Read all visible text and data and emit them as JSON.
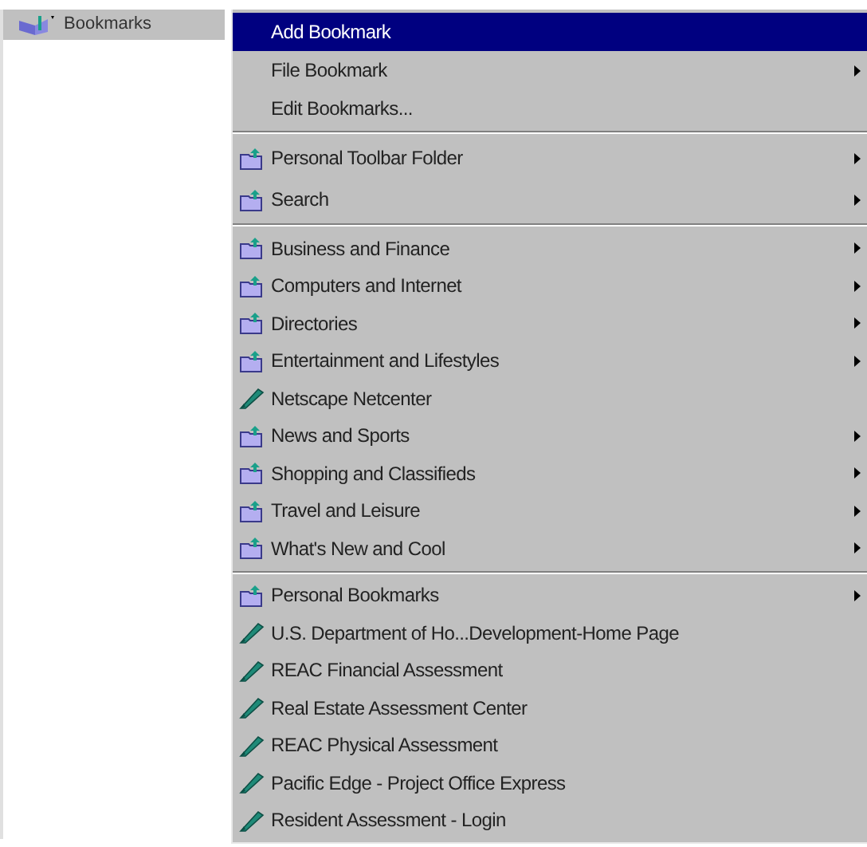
{
  "bookmarks_button": {
    "label": "Bookmarks"
  },
  "menu": {
    "groups": [
      {
        "items": [
          {
            "kind": "command",
            "label": "Add Bookmark",
            "selected": true,
            "has_submenu": false
          },
          {
            "kind": "command",
            "label": "File Bookmark",
            "selected": false,
            "has_submenu": true
          },
          {
            "kind": "command",
            "label": "Edit Bookmarks...",
            "selected": false,
            "has_submenu": false
          }
        ]
      },
      {
        "items": [
          {
            "kind": "folder",
            "label": "Personal Toolbar Folder",
            "selected": false,
            "has_submenu": true
          },
          {
            "kind": "folder",
            "label": "Search",
            "selected": false,
            "has_submenu": true
          }
        ]
      },
      {
        "items": [
          {
            "kind": "folder",
            "label": "Business and Finance",
            "selected": false,
            "has_submenu": true
          },
          {
            "kind": "folder",
            "label": "Computers and Internet",
            "selected": false,
            "has_submenu": true
          },
          {
            "kind": "folder",
            "label": "Directories",
            "selected": false,
            "has_submenu": true
          },
          {
            "kind": "folder",
            "label": "Entertainment and Lifestyles",
            "selected": false,
            "has_submenu": true
          },
          {
            "kind": "bookmark",
            "label": "Netscape Netcenter",
            "selected": false,
            "has_submenu": false
          },
          {
            "kind": "folder",
            "label": "News and Sports",
            "selected": false,
            "has_submenu": true
          },
          {
            "kind": "folder",
            "label": "Shopping and Classifieds",
            "selected": false,
            "has_submenu": true
          },
          {
            "kind": "folder",
            "label": "Travel and Leisure",
            "selected": false,
            "has_submenu": true
          },
          {
            "kind": "folder",
            "label": "What's New and Cool",
            "selected": false,
            "has_submenu": true
          }
        ]
      },
      {
        "items": [
          {
            "kind": "folder",
            "label": "Personal Bookmarks",
            "selected": false,
            "has_submenu": true
          },
          {
            "kind": "bookmark",
            "label": "U.S. Department of Ho...Development-Home Page",
            "selected": false,
            "has_submenu": false
          },
          {
            "kind": "bookmark",
            "label": "REAC Financial Assessment",
            "selected": false,
            "has_submenu": false
          },
          {
            "kind": "bookmark",
            "label": "Real Estate Assessment Center",
            "selected": false,
            "has_submenu": false
          },
          {
            "kind": "bookmark",
            "label": "REAC Physical Assessment",
            "selected": false,
            "has_submenu": false
          },
          {
            "kind": "bookmark",
            "label": "Pacific Edge - Project Office Express",
            "selected": false,
            "has_submenu": false
          },
          {
            "kind": "bookmark",
            "label": "Resident Assessment - Login",
            "selected": false,
            "has_submenu": false
          }
        ]
      }
    ]
  }
}
